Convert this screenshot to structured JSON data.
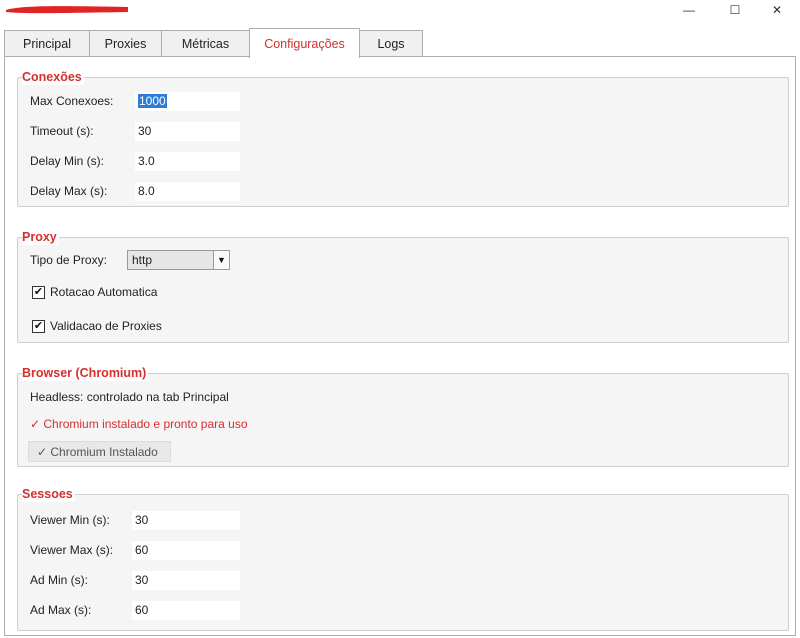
{
  "window": {
    "controls": {
      "minimize": "—",
      "maximize": "☐",
      "close": "✕"
    }
  },
  "tabs": [
    {
      "label": "Principal"
    },
    {
      "label": "Proxies"
    },
    {
      "label": "Métricas"
    },
    {
      "label": "Configurações",
      "active": true
    },
    {
      "label": "Logs"
    }
  ],
  "connections": {
    "title": "Conexões",
    "fields": [
      {
        "label": "Max Conexoes:",
        "value": "1000",
        "selected": true
      },
      {
        "label": "Timeout (s):",
        "value": "30"
      },
      {
        "label": "Delay Min (s):",
        "value": "3.0"
      },
      {
        "label": "Delay Max (s):",
        "value": "8.0"
      }
    ]
  },
  "proxy": {
    "title": "Proxy",
    "type_label": "Tipo de Proxy:",
    "type_value": "http",
    "checkboxes": [
      {
        "label": "Rotacao Automatica",
        "checked": true
      },
      {
        "label": "Validacao de Proxies",
        "checked": true
      }
    ]
  },
  "browser": {
    "title": "Browser (Chromium)",
    "headless_note": "Headless: controlado na tab Principal",
    "status": "✓ Chromium instalado e pronto para uso",
    "button_label": "✓ Chromium Instalado"
  },
  "sessions": {
    "title": "Sessoes",
    "fields": [
      {
        "label": "Viewer Min (s):",
        "value": "30"
      },
      {
        "label": "Viewer Max (s):",
        "value": "60"
      },
      {
        "label": "Ad Min (s):",
        "value": "30"
      },
      {
        "label": "Ad Max (s):",
        "value": "60"
      }
    ]
  },
  "colors": {
    "accent": "#d3302f",
    "selection": "#2f7cd6",
    "group_bg": "#f5f5f5"
  }
}
